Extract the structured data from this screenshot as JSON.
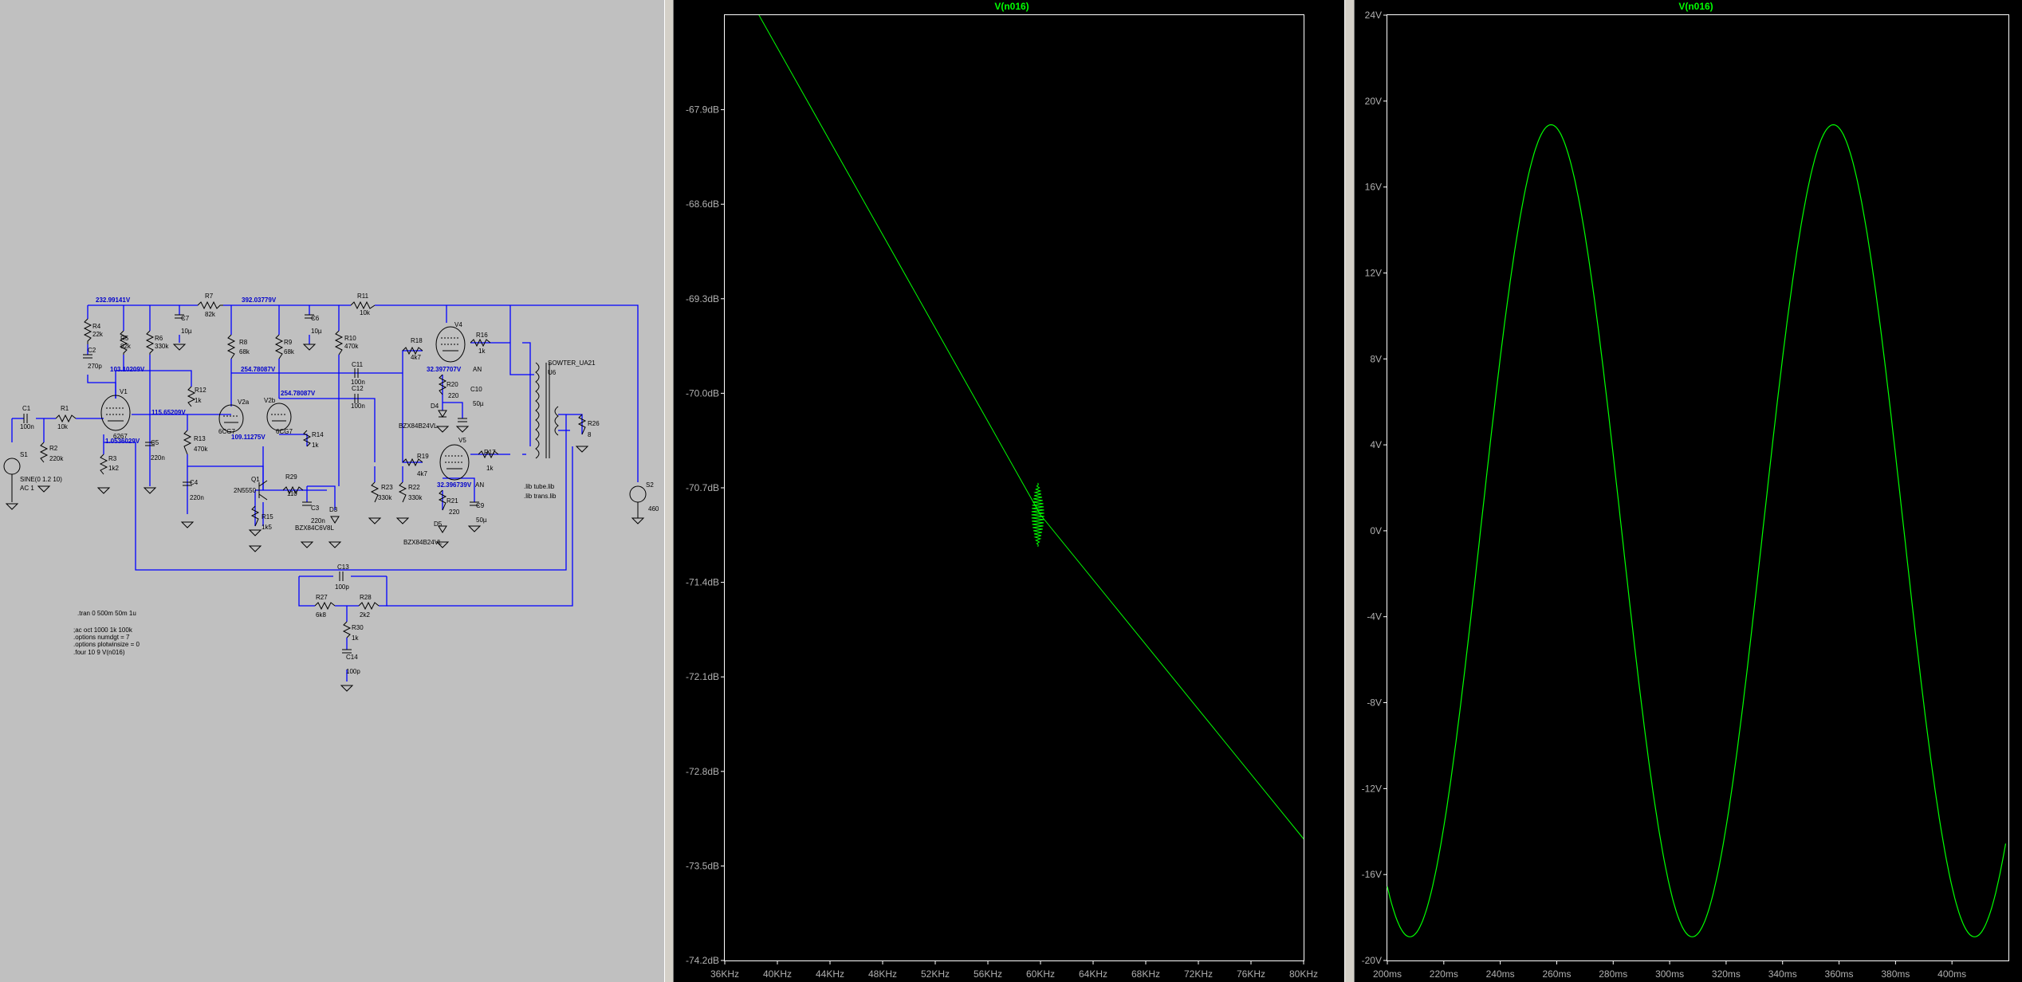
{
  "schematic": {
    "voltages": [
      "232.99141V",
      "392.03779V",
      "103.10209V",
      "115.65209V",
      "1.0536029V",
      "254.78087V",
      "254.78087V",
      "109.11275V",
      "32.397707V",
      "32.396739V"
    ],
    "parts": [
      {
        "ref": "R4",
        "val": "22k"
      },
      {
        "ref": "R5",
        "val": "82k"
      },
      {
        "ref": "R6",
        "val": "330k"
      },
      {
        "ref": "R7",
        "val": "82k"
      },
      {
        "ref": "C7",
        "val": "10µ"
      },
      {
        "ref": "R8",
        "val": "68k"
      },
      {
        "ref": "R9",
        "val": "68k"
      },
      {
        "ref": "C6",
        "val": "10µ"
      },
      {
        "ref": "R10",
        "val": "470k"
      },
      {
        "ref": "R11",
        "val": "10k"
      },
      {
        "ref": "C2",
        "val": "270p"
      },
      {
        "ref": "R12",
        "val": "1k"
      },
      {
        "ref": "R13",
        "val": "470k"
      },
      {
        "ref": "C5",
        "val": "220n"
      },
      {
        "ref": "C4",
        "val": "220n"
      },
      {
        "ref": "R1",
        "val": "10k"
      },
      {
        "ref": "C1",
        "val": "100n"
      },
      {
        "ref": "R2",
        "val": "220k"
      },
      {
        "ref": "R3",
        "val": "1k2"
      },
      {
        "ref": "C11",
        "val": "100n"
      },
      {
        "ref": "C12",
        "val": "100n"
      },
      {
        "ref": "R14",
        "val": "1k"
      },
      {
        "ref": "R18",
        "val": "4k7"
      },
      {
        "ref": "R16",
        "val": "1k"
      },
      {
        "ref": "R20",
        "val": "220"
      },
      {
        "ref": "C10",
        "val": "50µ"
      },
      {
        "ref": "R19",
        "val": "4k7"
      },
      {
        "ref": "R17",
        "val": "1k"
      },
      {
        "ref": "R21",
        "val": "220"
      },
      {
        "ref": "C9",
        "val": "50µ"
      },
      {
        "ref": "R23",
        "val": "330k"
      },
      {
        "ref": "R22",
        "val": "330k"
      },
      {
        "ref": "R29",
        "val": "110"
      },
      {
        "ref": "C3",
        "val": "220n"
      },
      {
        "ref": "R15",
        "val": "1k5"
      },
      {
        "ref": "R26",
        "val": "8"
      },
      {
        "ref": "C13",
        "val": "100p"
      },
      {
        "ref": "R27",
        "val": "6k8"
      },
      {
        "ref": "R28",
        "val": "2k2"
      },
      {
        "ref": "R30",
        "val": "1k"
      },
      {
        "ref": "C14",
        "val": "100p"
      }
    ],
    "tubes": {
      "v1": "V1",
      "v1_model": "6267",
      "v2a": "V2a",
      "v2a_model": "6CG7",
      "v2b": "V2b",
      "v2b_model": "6CG7",
      "v4": "V4",
      "v5": "V5",
      "an1": "AN",
      "an2": "AN"
    },
    "semis": {
      "q1": "Q1",
      "q1_model": "2N5550",
      "d3": "D3",
      "d3_model": "BZX84C6V8L",
      "d4": "D4",
      "d4_model": "BZX84B24VL",
      "d5": "D5",
      "d5_model": "BZX84B24VL"
    },
    "transformer": {
      "model": "SOWTER_UA21",
      "ref": "U6"
    },
    "sources": {
      "s1": "S1",
      "s1_val": "SINE(0 1.2 10)",
      "s1_ac": "AC 1",
      "s2": "S2",
      "s2_val": "460"
    },
    "libs": [
      ".lib tube.lib",
      ".lib trans.lib"
    ],
    "directives": [
      ".tran 0 500m 50m 1u",
      ";ac oct 1000 1k 100k",
      ".options numdgt = 7",
      ".options plotwinsize = 0",
      ".four 10 9  V(n016)"
    ]
  },
  "plot1": {
    "title": "V(n016)",
    "y_ticks": [
      "-67.9dB",
      "-68.6dB",
      "-69.3dB",
      "-70.0dB",
      "-70.7dB",
      "-71.4dB",
      "-72.1dB",
      "-72.8dB",
      "-73.5dB",
      "-74.2dB"
    ],
    "x_ticks": [
      "36KHz",
      "40KHz",
      "44KHz",
      "48KHz",
      "52KHz",
      "56KHz",
      "60KHz",
      "64KHz",
      "68KHz",
      "72KHz",
      "76KHz",
      "80KHz"
    ]
  },
  "plot2": {
    "title": "V(n016)",
    "y_ticks": [
      "24V",
      "20V",
      "16V",
      "12V",
      "8V",
      "4V",
      "0V",
      "-4V",
      "-8V",
      "-12V",
      "-16V",
      "-20V"
    ],
    "x_ticks": [
      "200ms",
      "220ms",
      "240ms",
      "260ms",
      "280ms",
      "300ms",
      "320ms",
      "340ms",
      "360ms",
      "380ms",
      "400ms"
    ]
  },
  "chart_data": [
    {
      "type": "line",
      "title": "V(n016)",
      "xlabel": "",
      "ylabel": "",
      "xlim": [
        36000,
        80000
      ],
      "ylim": [
        -74.2,
        -67.2
      ],
      "series": [
        {
          "x": [
            38600,
            60000,
            80000
          ],
          "y": [
            -67.2,
            -70.9,
            -73.3
          ]
        }
      ],
      "annotations": [
        "spike near 60KHz"
      ],
      "grid": false
    },
    {
      "type": "line",
      "title": "V(n016)",
      "xlabel": "",
      "ylabel": "",
      "xlim": [
        200,
        420
      ],
      "ylim": [
        -20,
        24
      ],
      "series": [
        {
          "note": "sine",
          "amplitude": 18.9,
          "period_ms": 100,
          "peak_ms": 258,
          "offset": 0
        }
      ],
      "grid": false
    }
  ]
}
